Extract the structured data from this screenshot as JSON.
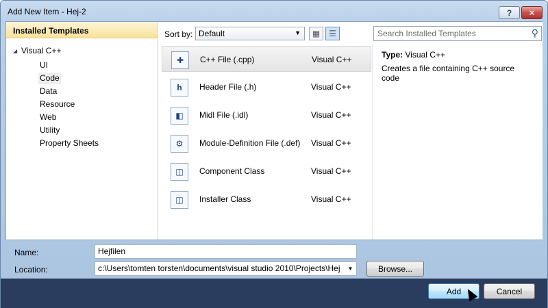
{
  "window": {
    "title": "Add New Item - Hej-2",
    "help_label": "?",
    "close_label": "✕"
  },
  "left_pane": {
    "header": "Installed Templates",
    "root": "Visual C++",
    "items": [
      "UI",
      "Code",
      "Data",
      "Resource",
      "Web",
      "Utility",
      "Property Sheets"
    ],
    "selected": "Code"
  },
  "toolbar": {
    "sort_label": "Sort by:",
    "sort_value": "Default",
    "search_placeholder": "Search Installed Templates"
  },
  "templates": [
    {
      "name": "C++ File (.cpp)",
      "language": "Visual C++",
      "icon": "cpp-file-icon",
      "glyph": "✚"
    },
    {
      "name": "Header File (.h)",
      "language": "Visual C++",
      "icon": "header-file-icon",
      "glyph": "h"
    },
    {
      "name": "Midl File (.idl)",
      "language": "Visual C++",
      "icon": "midl-file-icon",
      "glyph": "◧"
    },
    {
      "name": "Module-Definition File (.def)",
      "language": "Visual C++",
      "icon": "module-definition-icon",
      "glyph": "⚙"
    },
    {
      "name": "Component Class",
      "language": "Visual C++",
      "icon": "component-class-icon",
      "glyph": "◫"
    },
    {
      "name": "Installer Class",
      "language": "Visual C++",
      "icon": "installer-class-icon",
      "glyph": "◫"
    }
  ],
  "details": {
    "type_label": "Type:",
    "type_value": "Visual C++",
    "description": "Creates a file containing C++ source code"
  },
  "form": {
    "name_label": "Name:",
    "name_value": "Hejfilen",
    "location_label": "Location:",
    "location_value": "c:\\Users\\tomten torsten\\documents\\visual studio 2010\\Projects\\Hej",
    "browse_label": "Browse..."
  },
  "buttons": {
    "add": "Add",
    "cancel": "Cancel"
  }
}
